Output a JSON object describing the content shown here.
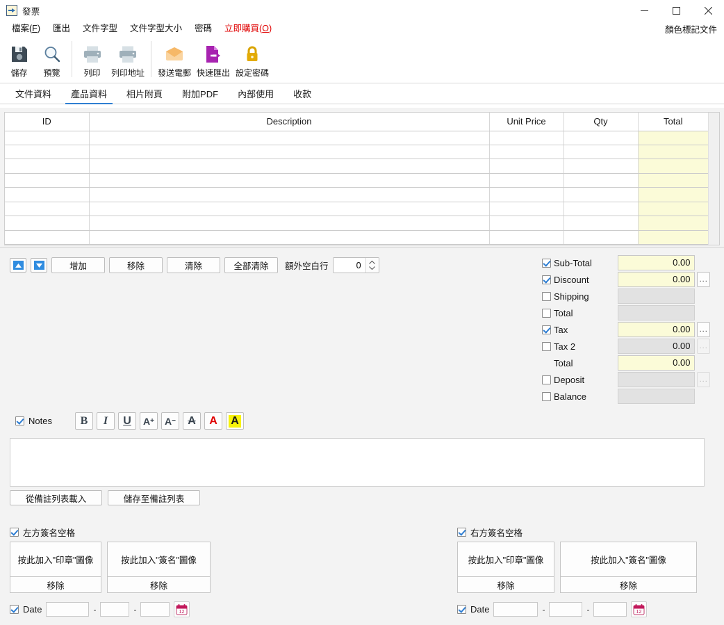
{
  "window": {
    "title": "發票",
    "icon": "invoice-export-icon",
    "buttons": {
      "minimize": "—",
      "maximize": "□",
      "close": "✕"
    }
  },
  "menubar": {
    "items": [
      {
        "label": "檔案(F)",
        "accel": "F"
      },
      {
        "label": "匯出"
      },
      {
        "label": "文件字型"
      },
      {
        "label": "文件字型大小"
      },
      {
        "label": "密碼"
      },
      {
        "label": "立即購買(O)",
        "accel": "O",
        "color": "#e00000"
      }
    ],
    "right_label": "顏色標記文件"
  },
  "toolbar": {
    "items": [
      {
        "label": "儲存",
        "icon": "save-floppy-icon",
        "color": "#3d4a55"
      },
      {
        "label": "預覽",
        "icon": "magnifier-icon",
        "color": "#5b7f9e"
      },
      {
        "label": "列印",
        "icon": "printer-icon",
        "color": "#9fb0ba"
      },
      {
        "label": "列印地址",
        "icon": "printer-address-icon",
        "color": "#9fb0ba"
      },
      {
        "label": "發送電郵",
        "icon": "envelope-icon",
        "color": "#f7bc6a"
      },
      {
        "label": "快速匯出",
        "icon": "export-document-icon",
        "color": "#a723b0"
      },
      {
        "label": "設定密碼",
        "icon": "lock-icon",
        "color": "#d9a400"
      }
    ]
  },
  "tabs": {
    "active_index": 1,
    "items": [
      {
        "label": "文件資料"
      },
      {
        "label": "產品資料"
      },
      {
        "label": "相片附頁"
      },
      {
        "label": "附加PDF"
      },
      {
        "label": "內部使用"
      },
      {
        "label": "收款"
      }
    ]
  },
  "grid": {
    "columns": [
      "ID",
      "Description",
      "Unit Price",
      "Qty",
      "Total"
    ],
    "rows": [
      [
        "",
        "",
        "",
        "",
        ""
      ],
      [
        "",
        "",
        "",
        "",
        ""
      ],
      [
        "",
        "",
        "",
        "",
        ""
      ],
      [
        "",
        "",
        "",
        "",
        ""
      ],
      [
        "",
        "",
        "",
        "",
        ""
      ],
      [
        "",
        "",
        "",
        "",
        ""
      ],
      [
        "",
        "",
        "",
        "",
        ""
      ],
      [
        "",
        "",
        "",
        "",
        ""
      ]
    ],
    "highlight_column": 4,
    "highlight_color": "#fbfbd8"
  },
  "actions": {
    "move_up": "▲",
    "move_down": "▼",
    "add": "增加",
    "remove": "移除",
    "clear": "清除",
    "clear_all": "全部清除",
    "blank_rows_label": "額外空白行",
    "blank_rows_value": "0"
  },
  "totals": {
    "rows": [
      {
        "label": "Sub-Total",
        "checked": true,
        "value": "0.00",
        "enabled": true,
        "has_dots": false
      },
      {
        "label": "Discount",
        "checked": true,
        "value": "0.00",
        "enabled": true,
        "has_dots": true,
        "dots_enabled": true
      },
      {
        "label": "Shipping",
        "checked": false,
        "value": "",
        "enabled": false,
        "has_dots": false
      },
      {
        "label": "Total",
        "checked": false,
        "value": "",
        "enabled": false,
        "has_dots": false
      },
      {
        "label": "Tax",
        "checked": true,
        "value": "0.00",
        "enabled": true,
        "has_dots": true,
        "dots_enabled": true
      },
      {
        "label": "Tax 2",
        "checked": false,
        "value": "0.00",
        "enabled": false,
        "has_dots": true,
        "dots_enabled": false
      },
      {
        "label": "Total",
        "checked": null,
        "value": "0.00",
        "enabled": true,
        "has_dots": false,
        "indent": true
      },
      {
        "label": "Deposit",
        "checked": false,
        "value": "",
        "enabled": false,
        "has_dots": true,
        "dots_enabled": false
      },
      {
        "label": "Balance",
        "checked": false,
        "value": "",
        "enabled": false,
        "has_dots": false
      }
    ],
    "dots_label": "..."
  },
  "notes": {
    "label": "Notes",
    "checked": true,
    "value": "",
    "format_buttons": [
      {
        "name": "bold",
        "glyph": "B"
      },
      {
        "name": "italic",
        "glyph": "I"
      },
      {
        "name": "underline",
        "glyph": "U"
      },
      {
        "name": "font-larger",
        "glyph": "A+"
      },
      {
        "name": "font-smaller",
        "glyph": "A−"
      },
      {
        "name": "strikethrough",
        "glyph": "A"
      },
      {
        "name": "font-color",
        "glyph": "A"
      },
      {
        "name": "highlight-color",
        "glyph": "A"
      }
    ],
    "load_button": "從備註列表載入",
    "save_button": "儲存至備註列表"
  },
  "signature_left": {
    "title": "左方簽名空格",
    "checked": true,
    "stamp_button": "按此加入\"印章\"圖像",
    "stamp_remove": "移除",
    "sign_button": "按此加入\"簽名\"圖像",
    "sign_remove": "移除",
    "date_label": "Date",
    "date_checked": true,
    "date_year": "",
    "date_month": "",
    "date_day": "",
    "date_sep": "-"
  },
  "signature_right": {
    "title": "右方簽名空格",
    "checked": true,
    "stamp_button": "按此加入\"印章\"圖像",
    "stamp_remove": "移除",
    "sign_button": "按此加入\"簽名\"圖像",
    "sign_remove": "移除",
    "date_label": "Date",
    "date_checked": true,
    "date_year": "",
    "date_month": "",
    "date_day": "",
    "date_sep": "-"
  },
  "colors": {
    "accent": "#2f7fd1",
    "panel": "#f3f3f3",
    "yellow_field": "#fbfbd8",
    "disabled_field": "#e2e2e2",
    "buy_red": "#e00000"
  }
}
